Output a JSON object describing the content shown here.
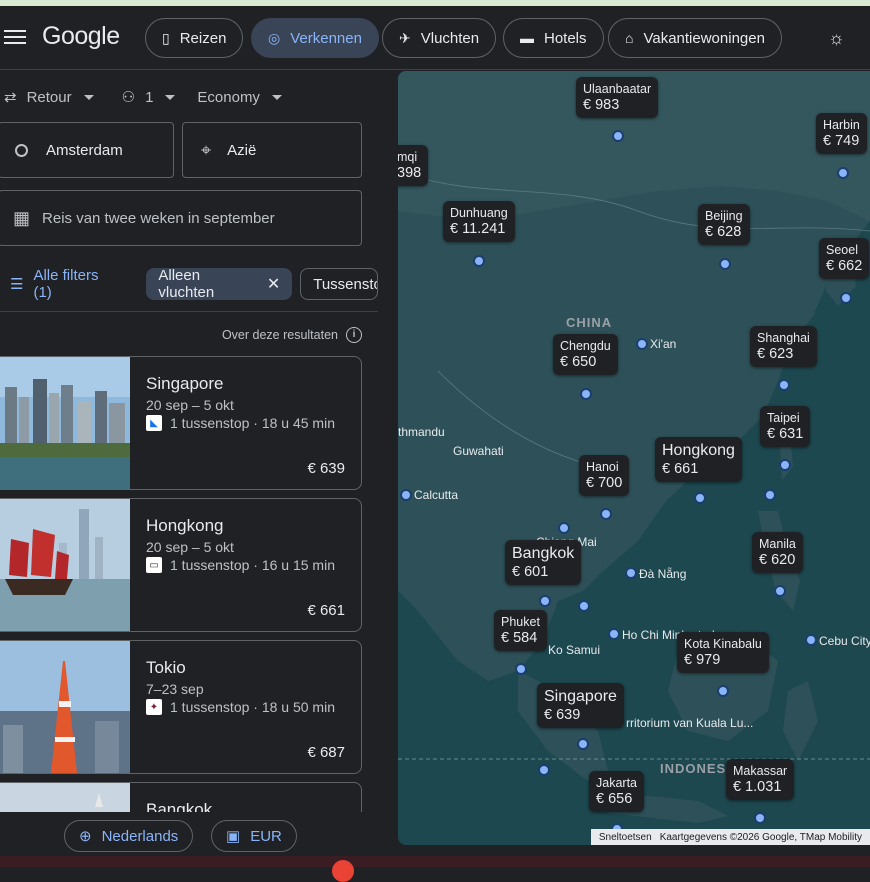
{
  "header": {
    "logo": "Google",
    "tabs": [
      {
        "label": "Reizen",
        "icon": "suitcase-icon"
      },
      {
        "label": "Verkennen",
        "icon": "explore-icon"
      },
      {
        "label": "Vluchten",
        "icon": "plane-icon"
      },
      {
        "label": "Hotels",
        "icon": "bed-icon"
      },
      {
        "label": "Vakantiewoningen",
        "icon": "house-icon"
      }
    ],
    "theme_icon": "brightness-icon"
  },
  "search": {
    "trip_type": "Retour",
    "passengers": "1",
    "cabin": "Economy",
    "origin": "Amsterdam",
    "destination": "Azië",
    "dates": "Reis van twee weken in september"
  },
  "filters": {
    "all": "Alle filters (1)",
    "chips": [
      "Alleen vluchten",
      "Tussenstops"
    ]
  },
  "about": "Over deze resultaten",
  "results": [
    {
      "city": "Singapore",
      "dates": "20 sep – 5 okt",
      "stops": "1 tussenstop · 18 u 45 min",
      "price": "€ 639"
    },
    {
      "city": "Hongkong",
      "dates": "20 sep – 5 okt",
      "stops": "1 tussenstop · 16 u 15 min",
      "price": "€ 661"
    },
    {
      "city": "Tokio",
      "dates": "7–23 sep",
      "stops": "1 tussenstop · 18 u 50 min",
      "price": "€ 687"
    },
    {
      "city": "Bangkok",
      "dates": "",
      "stops": "",
      "price": ""
    }
  ],
  "footer": {
    "language": "Nederlands",
    "currency": "EUR"
  },
  "map": {
    "price_labels": [
      {
        "name": "Ulaanbaatar",
        "price": "€ 983"
      },
      {
        "name": "Harbin",
        "price": "€ 749"
      },
      {
        "name": "mqi",
        "price": "398"
      },
      {
        "name": "Dunhuang",
        "price": "€ 11.241"
      },
      {
        "name": "Beijing",
        "price": "€ 628"
      },
      {
        "name": "Seoel",
        "price": "€ 662"
      },
      {
        "name": "Chengdu",
        "price": "€ 650"
      },
      {
        "name": "Shanghai",
        "price": "€ 623"
      },
      {
        "name": "Taipei",
        "price": "€ 631"
      },
      {
        "name": "Hongkong",
        "price": "€ 661"
      },
      {
        "name": "Hanoi",
        "price": "€ 700"
      },
      {
        "name": "Bangkok",
        "price": "€ 601"
      },
      {
        "name": "Manila",
        "price": "€ 620"
      },
      {
        "name": "Phuket",
        "price": "€ 584"
      },
      {
        "name": "Kota Kinabalu",
        "price": "€ 979"
      },
      {
        "name": "Singapore",
        "price": "€ 639"
      },
      {
        "name": "Jakarta",
        "price": "€ 656"
      },
      {
        "name": "Makassar",
        "price": "€ 1.031"
      }
    ],
    "place_labels": [
      "Xi'an",
      "thmandu",
      "Guwahati",
      "Calcutta",
      "Chiang Mai",
      "Đà Nẵng",
      "Ho Chi Minh-stad",
      "Ko Samui",
      "Cebu City",
      "rritorium van Kuala Lu..."
    ],
    "country_labels": [
      "CHINA",
      "INDONESIË"
    ],
    "attribution": [
      "Sneltoetsen",
      "Kaartgegevens ©2026 Google, TMap Mobility"
    ]
  }
}
